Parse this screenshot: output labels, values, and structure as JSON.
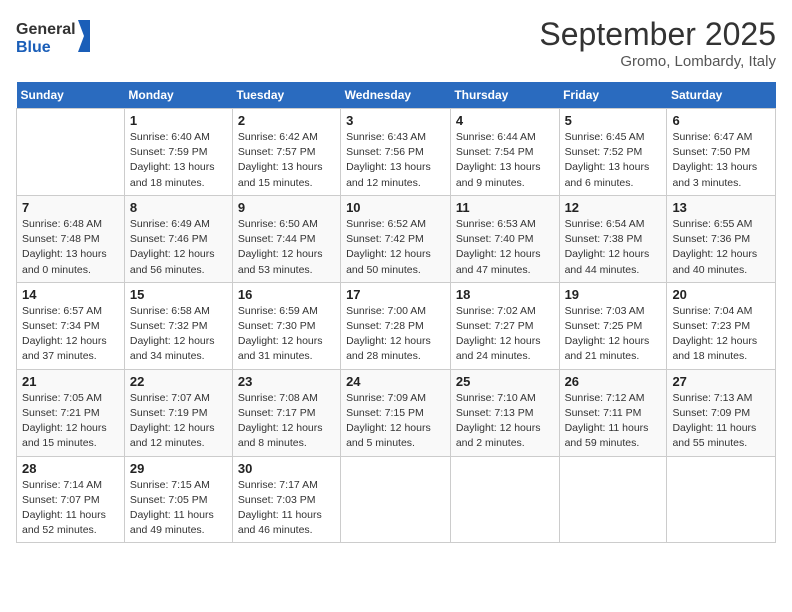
{
  "logo": {
    "line1": "General",
    "line2": "Blue"
  },
  "title": "September 2025",
  "subtitle": "Gromo, Lombardy, Italy",
  "header": {
    "days": [
      "Sunday",
      "Monday",
      "Tuesday",
      "Wednesday",
      "Thursday",
      "Friday",
      "Saturday"
    ]
  },
  "weeks": [
    [
      {
        "num": "",
        "info": ""
      },
      {
        "num": "1",
        "info": "Sunrise: 6:40 AM\nSunset: 7:59 PM\nDaylight: 13 hours\nand 18 minutes."
      },
      {
        "num": "2",
        "info": "Sunrise: 6:42 AM\nSunset: 7:57 PM\nDaylight: 13 hours\nand 15 minutes."
      },
      {
        "num": "3",
        "info": "Sunrise: 6:43 AM\nSunset: 7:56 PM\nDaylight: 13 hours\nand 12 minutes."
      },
      {
        "num": "4",
        "info": "Sunrise: 6:44 AM\nSunset: 7:54 PM\nDaylight: 13 hours\nand 9 minutes."
      },
      {
        "num": "5",
        "info": "Sunrise: 6:45 AM\nSunset: 7:52 PM\nDaylight: 13 hours\nand 6 minutes."
      },
      {
        "num": "6",
        "info": "Sunrise: 6:47 AM\nSunset: 7:50 PM\nDaylight: 13 hours\nand 3 minutes."
      }
    ],
    [
      {
        "num": "7",
        "info": "Sunrise: 6:48 AM\nSunset: 7:48 PM\nDaylight: 13 hours\nand 0 minutes."
      },
      {
        "num": "8",
        "info": "Sunrise: 6:49 AM\nSunset: 7:46 PM\nDaylight: 12 hours\nand 56 minutes."
      },
      {
        "num": "9",
        "info": "Sunrise: 6:50 AM\nSunset: 7:44 PM\nDaylight: 12 hours\nand 53 minutes."
      },
      {
        "num": "10",
        "info": "Sunrise: 6:52 AM\nSunset: 7:42 PM\nDaylight: 12 hours\nand 50 minutes."
      },
      {
        "num": "11",
        "info": "Sunrise: 6:53 AM\nSunset: 7:40 PM\nDaylight: 12 hours\nand 47 minutes."
      },
      {
        "num": "12",
        "info": "Sunrise: 6:54 AM\nSunset: 7:38 PM\nDaylight: 12 hours\nand 44 minutes."
      },
      {
        "num": "13",
        "info": "Sunrise: 6:55 AM\nSunset: 7:36 PM\nDaylight: 12 hours\nand 40 minutes."
      }
    ],
    [
      {
        "num": "14",
        "info": "Sunrise: 6:57 AM\nSunset: 7:34 PM\nDaylight: 12 hours\nand 37 minutes."
      },
      {
        "num": "15",
        "info": "Sunrise: 6:58 AM\nSunset: 7:32 PM\nDaylight: 12 hours\nand 34 minutes."
      },
      {
        "num": "16",
        "info": "Sunrise: 6:59 AM\nSunset: 7:30 PM\nDaylight: 12 hours\nand 31 minutes."
      },
      {
        "num": "17",
        "info": "Sunrise: 7:00 AM\nSunset: 7:28 PM\nDaylight: 12 hours\nand 28 minutes."
      },
      {
        "num": "18",
        "info": "Sunrise: 7:02 AM\nSunset: 7:27 PM\nDaylight: 12 hours\nand 24 minutes."
      },
      {
        "num": "19",
        "info": "Sunrise: 7:03 AM\nSunset: 7:25 PM\nDaylight: 12 hours\nand 21 minutes."
      },
      {
        "num": "20",
        "info": "Sunrise: 7:04 AM\nSunset: 7:23 PM\nDaylight: 12 hours\nand 18 minutes."
      }
    ],
    [
      {
        "num": "21",
        "info": "Sunrise: 7:05 AM\nSunset: 7:21 PM\nDaylight: 12 hours\nand 15 minutes."
      },
      {
        "num": "22",
        "info": "Sunrise: 7:07 AM\nSunset: 7:19 PM\nDaylight: 12 hours\nand 12 minutes."
      },
      {
        "num": "23",
        "info": "Sunrise: 7:08 AM\nSunset: 7:17 PM\nDaylight: 12 hours\nand 8 minutes."
      },
      {
        "num": "24",
        "info": "Sunrise: 7:09 AM\nSunset: 7:15 PM\nDaylight: 12 hours\nand 5 minutes."
      },
      {
        "num": "25",
        "info": "Sunrise: 7:10 AM\nSunset: 7:13 PM\nDaylight: 12 hours\nand 2 minutes."
      },
      {
        "num": "26",
        "info": "Sunrise: 7:12 AM\nSunset: 7:11 PM\nDaylight: 11 hours\nand 59 minutes."
      },
      {
        "num": "27",
        "info": "Sunrise: 7:13 AM\nSunset: 7:09 PM\nDaylight: 11 hours\nand 55 minutes."
      }
    ],
    [
      {
        "num": "28",
        "info": "Sunrise: 7:14 AM\nSunset: 7:07 PM\nDaylight: 11 hours\nand 52 minutes."
      },
      {
        "num": "29",
        "info": "Sunrise: 7:15 AM\nSunset: 7:05 PM\nDaylight: 11 hours\nand 49 minutes."
      },
      {
        "num": "30",
        "info": "Sunrise: 7:17 AM\nSunset: 7:03 PM\nDaylight: 11 hours\nand 46 minutes."
      },
      {
        "num": "",
        "info": ""
      },
      {
        "num": "",
        "info": ""
      },
      {
        "num": "",
        "info": ""
      },
      {
        "num": "",
        "info": ""
      }
    ]
  ]
}
